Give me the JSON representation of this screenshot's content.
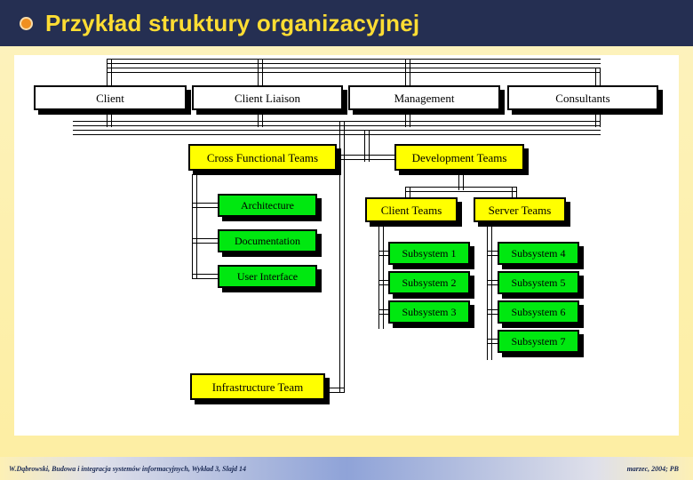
{
  "slide": {
    "title": "Przykład struktury organizacyjnej",
    "bullet_icon": "bullet-dot-icon",
    "title_bar_color": "#252f52",
    "title_text_color": "#ffdd33",
    "bullet_color": "#f09020",
    "background_color": "#fdf0ad",
    "canvas_color": "#ffffff"
  },
  "colors": {
    "white_box": "#ffffff",
    "yellow_box": "#ffff00",
    "green_box": "#00e810",
    "line": "#000000",
    "shadow": "#000000"
  },
  "chart_data": {
    "type": "diagram",
    "title": "Przykład struktury organizacyjnej",
    "diagram_kind": "organizational-chart",
    "nodes": [
      {
        "id": "client",
        "label": "Client",
        "level": 1,
        "color": "white"
      },
      {
        "id": "client-liaison",
        "label": "Client Liaison",
        "level": 1,
        "color": "white"
      },
      {
        "id": "management",
        "label": "Management",
        "level": 1,
        "color": "white"
      },
      {
        "id": "consultants",
        "label": "Consultants",
        "level": 1,
        "color": "white"
      },
      {
        "id": "cross-functional",
        "label": "Cross Functional Teams",
        "level": 2,
        "color": "yellow"
      },
      {
        "id": "development",
        "label": "Development Teams",
        "level": 2,
        "color": "yellow"
      },
      {
        "id": "architecture",
        "label": "Architecture",
        "level": 3,
        "color": "green"
      },
      {
        "id": "documentation",
        "label": "Documentation",
        "level": 3,
        "color": "green"
      },
      {
        "id": "user-interface",
        "label": "User Interface",
        "level": 3,
        "color": "green"
      },
      {
        "id": "client-teams",
        "label": "Client Teams",
        "level": 3,
        "color": "yellow"
      },
      {
        "id": "server-teams",
        "label": "Server Teams",
        "level": 3,
        "color": "yellow"
      },
      {
        "id": "subsystem-1",
        "label": "Subsystem 1",
        "level": 4,
        "color": "green"
      },
      {
        "id": "subsystem-2",
        "label": "Subsystem 2",
        "level": 4,
        "color": "green"
      },
      {
        "id": "subsystem-3",
        "label": "Subsystem 3",
        "level": 4,
        "color": "green"
      },
      {
        "id": "subsystem-4",
        "label": "Subsystem 4",
        "level": 4,
        "color": "green"
      },
      {
        "id": "subsystem-5",
        "label": "Subsystem 5",
        "level": 4,
        "color": "green"
      },
      {
        "id": "subsystem-6",
        "label": "Subsystem 6",
        "level": 4,
        "color": "green"
      },
      {
        "id": "subsystem-7",
        "label": "Subsystem 7",
        "level": 4,
        "color": "green"
      },
      {
        "id": "infrastructure",
        "label": "Infrastructure Team",
        "level": 2,
        "color": "yellow"
      }
    ],
    "edges": [
      {
        "from": "client",
        "to": "client-liaison"
      },
      {
        "from": "client-liaison",
        "to": "management"
      },
      {
        "from": "management",
        "to": "consultants"
      },
      {
        "from": "client-liaison",
        "to": "cross-functional"
      },
      {
        "from": "management",
        "to": "development"
      },
      {
        "from": "cross-functional",
        "to": "architecture"
      },
      {
        "from": "cross-functional",
        "to": "documentation"
      },
      {
        "from": "cross-functional",
        "to": "user-interface"
      },
      {
        "from": "development",
        "to": "client-teams"
      },
      {
        "from": "development",
        "to": "server-teams"
      },
      {
        "from": "client-teams",
        "to": "subsystem-1"
      },
      {
        "from": "client-teams",
        "to": "subsystem-2"
      },
      {
        "from": "client-teams",
        "to": "subsystem-3"
      },
      {
        "from": "server-teams",
        "to": "subsystem-4"
      },
      {
        "from": "server-teams",
        "to": "subsystem-5"
      },
      {
        "from": "server-teams",
        "to": "subsystem-6"
      },
      {
        "from": "server-teams",
        "to": "subsystem-7"
      },
      {
        "from": "consultants",
        "to": "infrastructure"
      }
    ]
  },
  "boxes": {
    "client": "Client",
    "client_liaison": "Client Liaison",
    "management": "Management",
    "consultants": "Consultants",
    "cross_functional_teams": "Cross Functional Teams",
    "development_teams": "Development Teams",
    "architecture": "Architecture",
    "documentation": "Documentation",
    "user_interface": "User Interface",
    "client_teams": "Client Teams",
    "server_teams": "Server Teams",
    "subsystem_1": "Subsystem 1",
    "subsystem_2": "Subsystem 2",
    "subsystem_3": "Subsystem 3",
    "subsystem_4": "Subsystem 4",
    "subsystem_5": "Subsystem 5",
    "subsystem_6": "Subsystem 6",
    "subsystem_7": "Subsystem 7",
    "infrastructure_team": "Infrastructure Team"
  },
  "footer": {
    "left": "W.Dąbrowski, Budowa i integracja systemów informacyjnych, Wykład 3, Slajd 14",
    "right": "marzec, 2004; PB"
  }
}
